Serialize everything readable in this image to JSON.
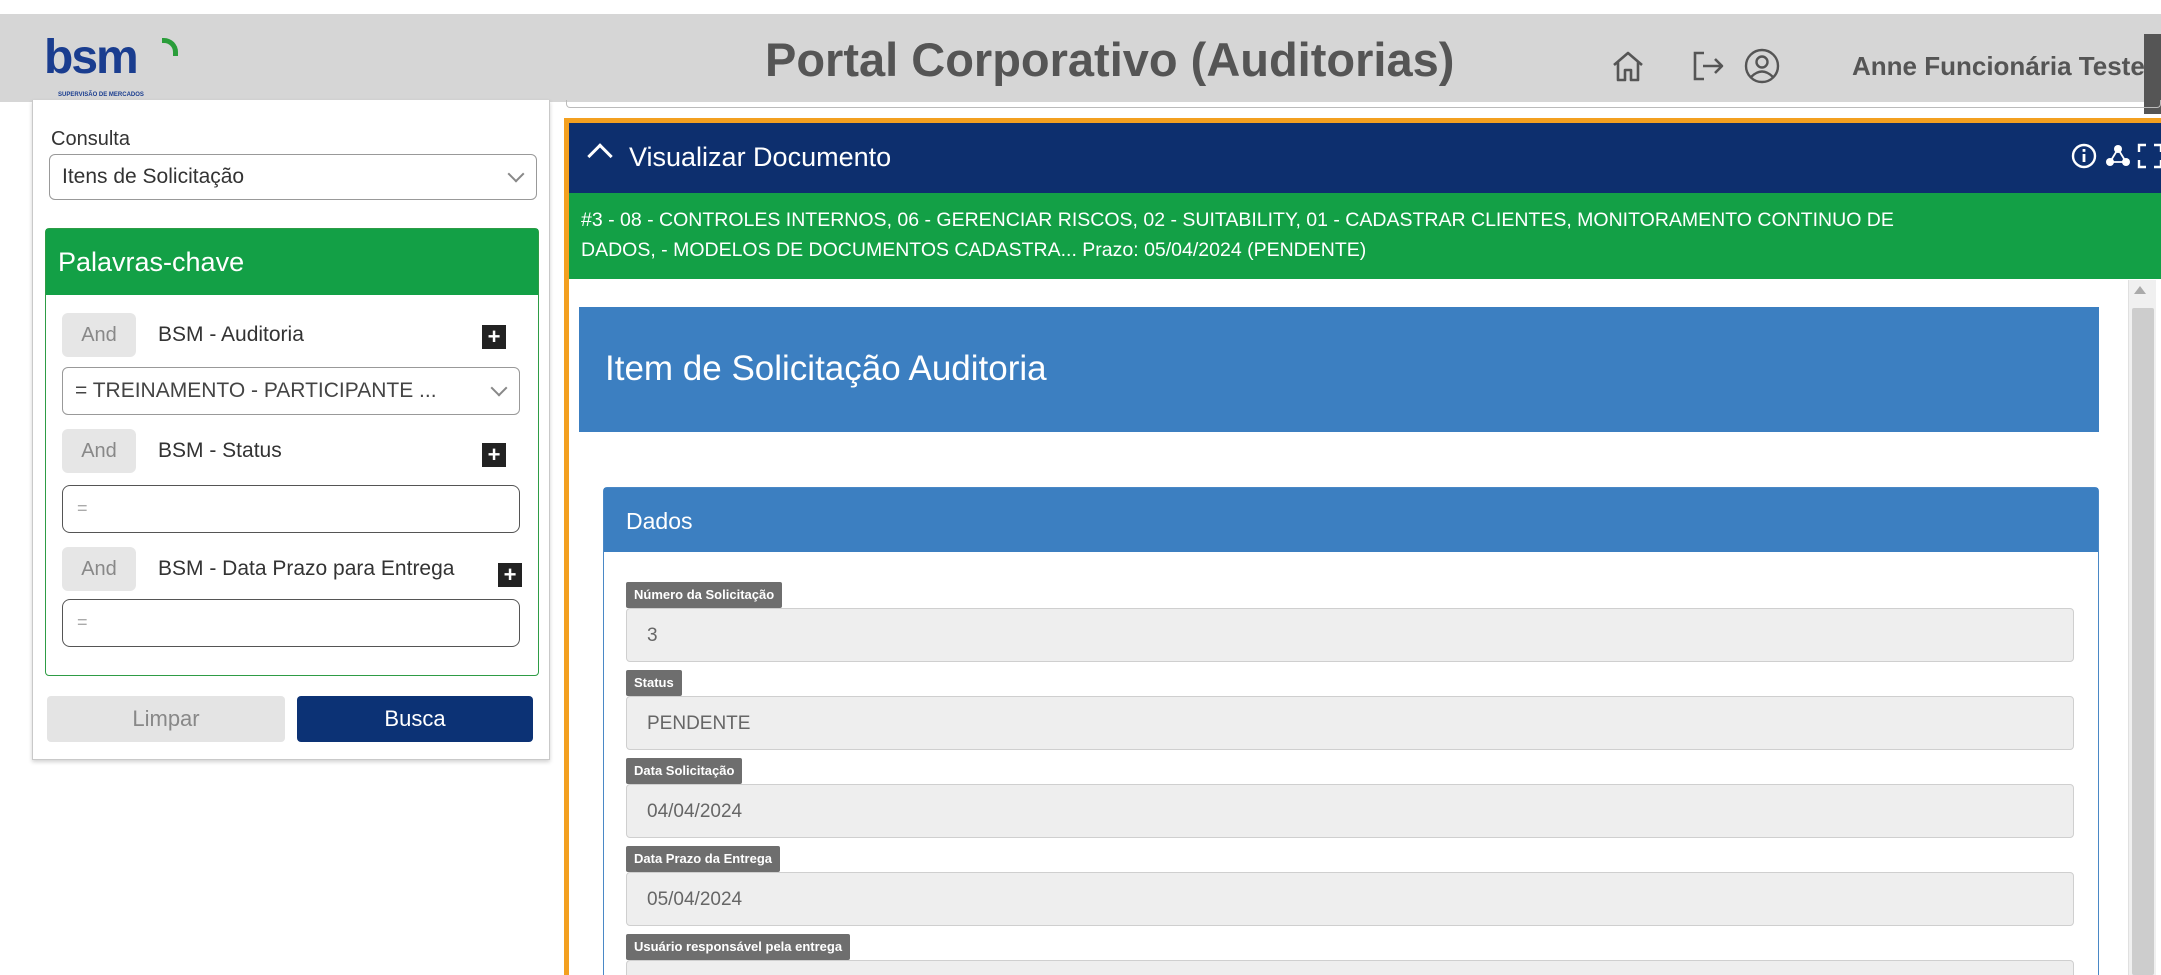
{
  "header": {
    "logo_text": "bsm",
    "logo_subtext": "SUPERVISÃO DE MERCADOS",
    "title": "Portal Corporativo (Auditorias)",
    "user_name": "Anne Funcionária Teste",
    "icons": [
      "home-icon",
      "logout-icon",
      "user-icon"
    ]
  },
  "sidebar": {
    "consulta_label": "Consulta",
    "consulta_value": "Itens de Solicitação",
    "keywords_title": "Palavras-chave",
    "filters": [
      {
        "operator": "And",
        "label": "BSM - Auditoria",
        "value": "= TREINAMENTO - PARTICIPANTE ..."
      },
      {
        "operator": "And",
        "label": "BSM - Status",
        "value": "="
      },
      {
        "operator": "And",
        "label": "BSM - Data Prazo para Entrega",
        "value": "="
      }
    ],
    "clear_label": "Limpar",
    "search_label": "Busca"
  },
  "viewer": {
    "title": "Visualizar Documento",
    "summary_line1": "#3 - 08 - CONTROLES INTERNOS, 06 - GERENCIAR RISCOS, 02 - SUITABILITY, 01 - CADASTRAR CLIENTES, MONITORAMENTO CONTINUO DE",
    "summary_line2": "DADOS, - MODELOS DE DOCUMENTOS CADASTRA... Prazo: 05/04/2024 (PENDENTE)",
    "doc_title": "Item de Solicitação Auditoria",
    "section_title": "Dados",
    "fields": [
      {
        "label": "Número da Solicitação",
        "value": "3"
      },
      {
        "label": "Status",
        "value": "PENDENTE"
      },
      {
        "label": "Data Solicitação",
        "value": "04/04/2024"
      },
      {
        "label": "Data Prazo da Entrega",
        "value": "05/04/2024"
      },
      {
        "label": "Usuário responsável pela entrega",
        "value": ""
      }
    ],
    "toolbar_icons": [
      "info-icon",
      "share-icon",
      "expand-icon"
    ]
  },
  "colors": {
    "header_bg": "#d6d6d6",
    "navy": "#0d2f6e",
    "green": "#13a046",
    "blue": "#3c7fc1",
    "orange_border": "#f3a020"
  }
}
